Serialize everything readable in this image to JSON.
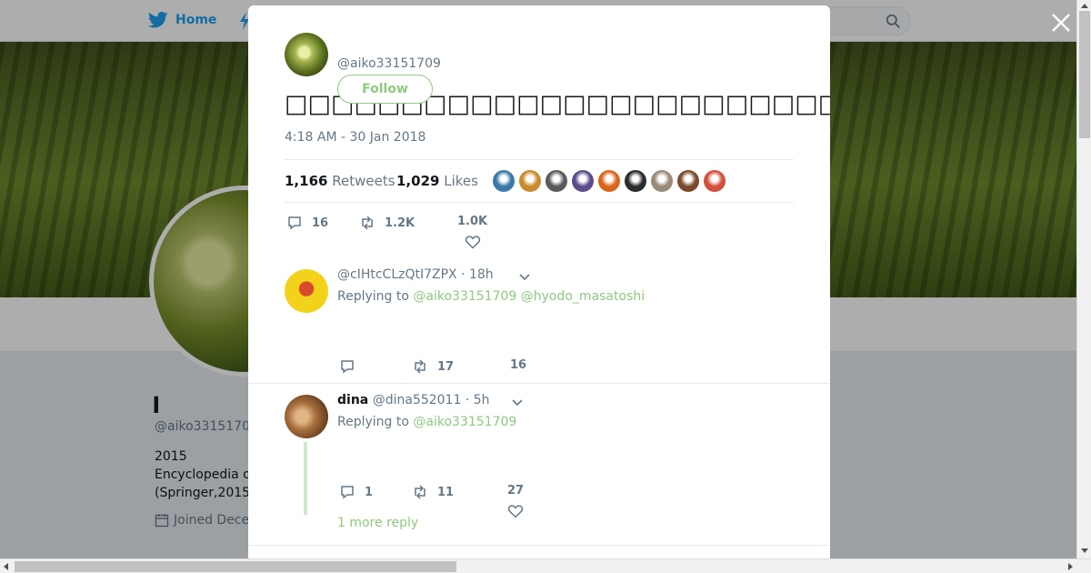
{
  "background_page": {
    "nav": {
      "home_label": "Home"
    },
    "profile": {
      "name": "𝄀𝄀𝄀𝄀𝄀",
      "handle": "@aiko33151709",
      "bio_line1": "2015",
      "bio_line2": "Encyclopedia o",
      "bio_line3": "(Springer,2015",
      "joined": "Joined Dece"
    }
  },
  "tweet": {
    "handle": "@aiko33151709",
    "follow_label": "Follow",
    "text": "□□□□□□□□□□□□□□□□□□□□□□□□□□□□□□□□□□□□□□□□□□□□□□□□□□",
    "timestamp": "4:18 AM - 30 Jan 2018",
    "retweets_count": "1,166",
    "retweets_label": "Retweets",
    "likes_count": "1,029",
    "likes_label": "Likes",
    "likers_colors": [
      "#3a78a8",
      "#c98a2e",
      "#5a5a5a",
      "#5b4c8a",
      "#d9641c",
      "#2b2b2b",
      "#9a8a78",
      "#7a4a2a",
      "#d0503a"
    ],
    "actions": {
      "replies": "16",
      "retweets": "1.2K",
      "likes": "1.0K"
    }
  },
  "replies": [
    {
      "display_name": "",
      "handle": "@cIHtcCLzQtI7ZPX",
      "time": "· 18h",
      "replying_prefix": "Replying to",
      "replying_to": [
        "@aiko33151709",
        "@hyodo_masatoshi"
      ],
      "reply_count": "",
      "retweet_count": "17",
      "like_count": "16",
      "avatar_color": "#f2d21b"
    },
    {
      "display_name": "dina",
      "handle": "@dina552011",
      "time": "· 5h",
      "replying_prefix": "Replying to",
      "replying_to": [
        "@aiko33151709"
      ],
      "reply_count": "1",
      "retweet_count": "11",
      "like_count": "27",
      "more_replies": "1 more reply",
      "avatar_color": "#8a5a34"
    }
  ],
  "colors": {
    "accent": "#8ec97f",
    "twitter_blue": "#1da1f2",
    "muted": "#657786"
  }
}
